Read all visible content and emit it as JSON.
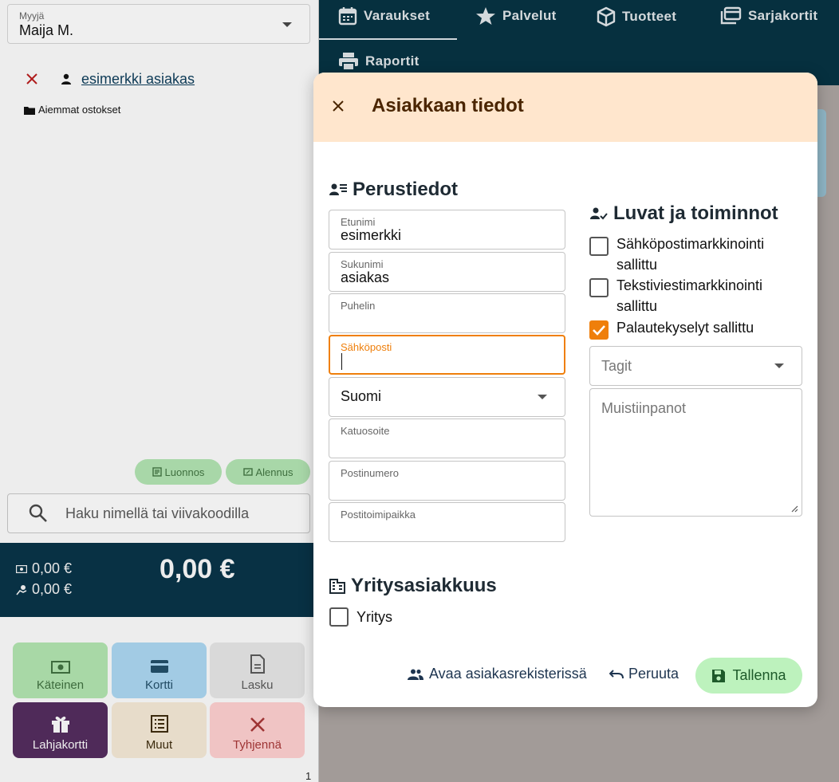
{
  "seller": {
    "label": "Myyjä",
    "value": "Maija M."
  },
  "customer": {
    "name": "esimerkki asiakas",
    "previous_purchases": "Aiemmat ostokset"
  },
  "chips": {
    "draft": "Luonnos",
    "discount": "Alennus"
  },
  "search": {
    "placeholder": "Haku nimellä tai viivakoodilla"
  },
  "totals": {
    "cash": "0,00 €",
    "change": "0,00 €",
    "grand_total": "0,00 €"
  },
  "payment_buttons": {
    "cash": "Käteinen",
    "card": "Kortti",
    "invoice": "Lasku",
    "gift_card": "Lahjakortti",
    "other": "Muut",
    "clear": "Tyhjennä"
  },
  "page_number": "1",
  "nav": {
    "reservations": "Varaukset",
    "services": "Palvelut",
    "products": "Tuotteet",
    "series_cards": "Sarjakortit",
    "reports": "Raportit"
  },
  "modal": {
    "title": "Asiakkaan tiedot",
    "basic_section": "Perustiedot",
    "fields": {
      "first_name": {
        "label": "Etunimi",
        "value": "esimerkki"
      },
      "last_name": {
        "label": "Sukunimi",
        "value": "asiakas"
      },
      "phone": {
        "label": "Puhelin",
        "value": ""
      },
      "email": {
        "label": "Sähköposti",
        "value": ""
      },
      "language": {
        "value": "Suomi"
      },
      "street": {
        "label": "Katuosoite",
        "value": ""
      },
      "postal_code": {
        "label": "Postinumero",
        "value": ""
      },
      "city": {
        "label": "Postitoimipaikka",
        "value": ""
      }
    },
    "permissions_section": "Luvat ja toiminnot",
    "permissions": {
      "email_marketing": {
        "label": "Sähköpostimarkkinointi sallittu",
        "checked": false
      },
      "sms_marketing": {
        "label": "Tekstiviestimarkkinointi sallittu",
        "checked": false
      },
      "feedback": {
        "label": "Palautekyselyt sallittu",
        "checked": true
      }
    },
    "tags_placeholder": "Tagit",
    "notes_placeholder": "Muistiinpanot",
    "company_section": "Yritysasiakkuus",
    "company_checkbox": {
      "label": "Yritys",
      "checked": false
    },
    "actions": {
      "open_register": "Avaa asiakasrekisterissä",
      "cancel": "Peruuta",
      "save": "Tallenna"
    }
  },
  "colors": {
    "accent_orange": "#ef7f0b",
    "nav_dark": "#06303f",
    "modal_header": "#ffe6cd",
    "save_green": "#bdf2bd"
  }
}
